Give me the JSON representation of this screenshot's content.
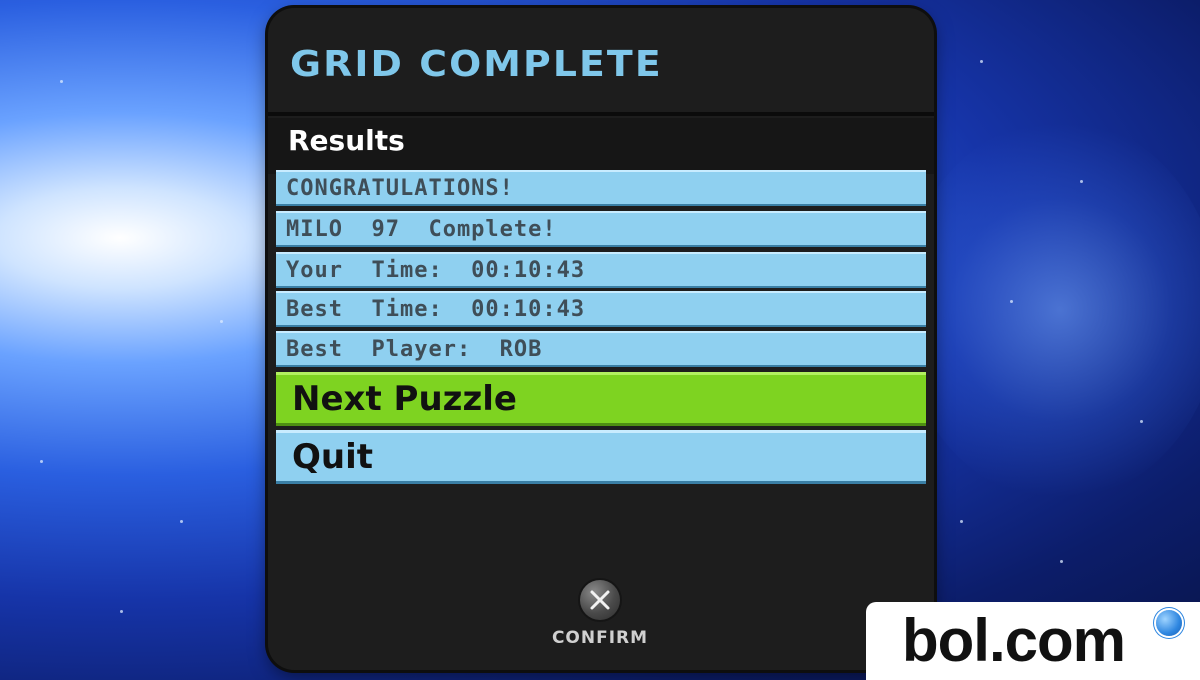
{
  "dialog": {
    "title": "GRID COMPLETE",
    "section_label": "Results"
  },
  "results": [
    {
      "text": "CONGRATULATIONS!"
    },
    {
      "text": "MILO  97  Complete!"
    },
    {
      "text": "Your  Time:  00:10:43"
    },
    {
      "text": "Best  Time:  00:10:43"
    },
    {
      "text": "Best  Player:  ROB"
    }
  ],
  "menu": {
    "items": [
      {
        "label": "Next Puzzle",
        "selected": true
      },
      {
        "label": "Quit",
        "selected": false
      }
    ]
  },
  "controls": {
    "confirm_label": "CONFIRM",
    "confirm_icon": "cross-button-icon"
  },
  "watermark": {
    "text": "bol.com"
  },
  "colors": {
    "title": "#7fc7ea",
    "row_bg": "#8fd0f0",
    "selected_bg": "#7ed321",
    "panel_bg": "#1d1d1d"
  }
}
